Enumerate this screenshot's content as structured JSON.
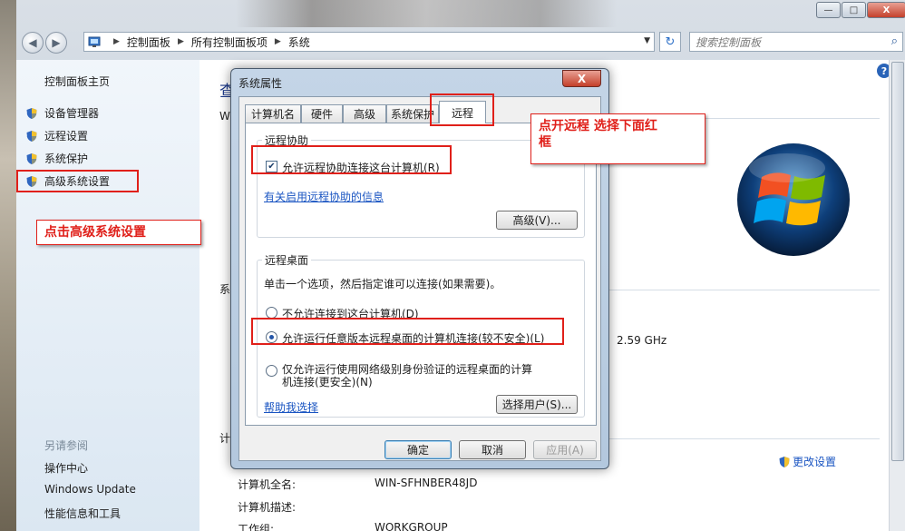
{
  "window": {
    "caption": {
      "minimize": "—",
      "maximize": "□",
      "close": "X"
    }
  },
  "nav": {
    "back_icon": "back-arrow-icon",
    "forward_icon": "forward-arrow-icon",
    "breadcrumb": [
      "控制面板",
      "所有控制面板项",
      "系统"
    ],
    "search_placeholder": "搜索控制面板"
  },
  "sidebar": {
    "home": "控制面板主页",
    "items": [
      {
        "label": "设备管理器",
        "icon": "shield-icon"
      },
      {
        "label": "远程设置",
        "icon": "shield-icon"
      },
      {
        "label": "系统保护",
        "icon": "shield-icon"
      },
      {
        "label": "高级系统设置",
        "icon": "shield-icon"
      }
    ],
    "see_also_heading": "另请参阅",
    "see_also": [
      "操作中心",
      "Windows Update",
      "性能信息和工具"
    ]
  },
  "main": {
    "title_partial": "查",
    "w_partial": "W",
    "xi_partial": "系",
    "ji_partial": "计",
    "cpu_speed": "2.59 GHz",
    "change_settings": "更改设置",
    "rows": [
      {
        "label": "计算机全名:",
        "value": "WIN-SFHNBER48JD"
      },
      {
        "label": "计算机描述:",
        "value": ""
      },
      {
        "label": "工作组:",
        "value": "WORKGROUP"
      }
    ]
  },
  "dialog": {
    "title": "系统属性",
    "close": "X",
    "tabs": [
      "计算机名",
      "硬件",
      "高级",
      "系统保护",
      "远程"
    ],
    "active_tab": "远程",
    "remote_assistance": {
      "heading": "远程协助",
      "allow_label": "允许远程协助连接这台计算机(R)",
      "allow_checked": true,
      "info_link": "有关启用远程协助的信息",
      "advanced_button": "高级(V)..."
    },
    "remote_desktop": {
      "heading": "远程桌面",
      "instruction": "单击一个选项，然后指定谁可以连接(如果需要)。",
      "options": [
        "不允许连接到这台计算机(D)",
        "允许运行任意版本远程桌面的计算机连接(较不安全)(L)",
        "仅允许运行使用网络级别身份验证的远程桌面的计算机连接(更安全)(N)"
      ],
      "option3_line1": "仅允许运行使用网络级别身份验证的远程桌面的计算",
      "option3_line2": "机连接(更安全)(N)",
      "selected_index": 1,
      "help_link": "帮助我选择",
      "select_users_button": "选择用户(S)..."
    },
    "buttons": {
      "ok": "确定",
      "cancel": "取消",
      "apply": "应用(A)"
    }
  },
  "annotations": {
    "left_callout": "点击高级系统设置",
    "right_callout_line1": "点开远程  选择下面红",
    "right_callout_line2": "框"
  },
  "colors": {
    "annotation_red": "#e0201a",
    "link_blue": "#1a55c2"
  }
}
